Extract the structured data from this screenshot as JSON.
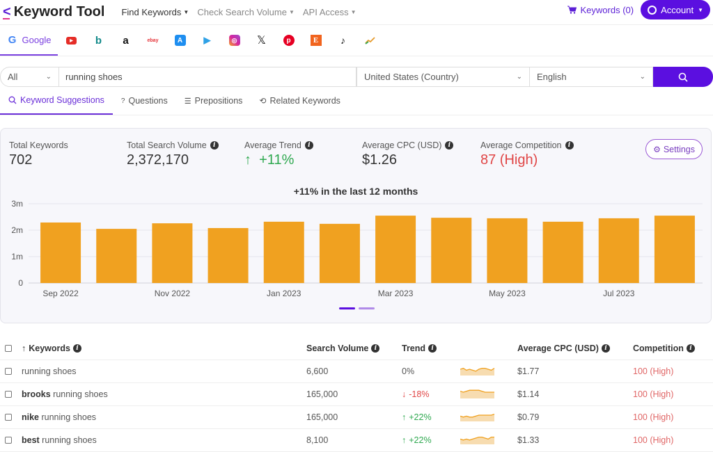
{
  "app": {
    "title": "Keyword Tool",
    "nav": [
      {
        "label": "Find Keywords",
        "active": true
      },
      {
        "label": "Check Search Volume",
        "active": false
      },
      {
        "label": "API Access",
        "active": false
      }
    ],
    "keywords_link": "Keywords (0)",
    "account_label": "Account"
  },
  "engines": [
    {
      "name": "google",
      "label": "Google",
      "active": true
    },
    {
      "name": "youtube"
    },
    {
      "name": "bing"
    },
    {
      "name": "amazon"
    },
    {
      "name": "ebay"
    },
    {
      "name": "app-store"
    },
    {
      "name": "play-store"
    },
    {
      "name": "instagram"
    },
    {
      "name": "x"
    },
    {
      "name": "pinterest"
    },
    {
      "name": "etsy"
    },
    {
      "name": "tiktok"
    },
    {
      "name": "trends"
    }
  ],
  "search": {
    "scope": "All",
    "query": "running shoes",
    "country": "United States (Country)",
    "language": "English"
  },
  "subtabs": [
    {
      "label": "Keyword Suggestions",
      "active": true
    },
    {
      "label": "Questions"
    },
    {
      "label": "Prepositions"
    },
    {
      "label": "Related Keywords"
    }
  ],
  "stats": {
    "total_keywords": {
      "label": "Total Keywords",
      "value": "702"
    },
    "total_search_volume": {
      "label": "Total Search Volume",
      "value": "2,372,170"
    },
    "average_trend": {
      "label": "Average Trend",
      "value": "+11%",
      "arrow": "↑"
    },
    "average_cpc": {
      "label": "Average CPC (USD)",
      "value": "$1.26"
    },
    "average_competition": {
      "label": "Average Competition",
      "value": "87 (High)"
    },
    "settings_label": "Settings"
  },
  "colors": {
    "accent": "#5b0fe0",
    "bar": "#f0a120",
    "positive": "#2ea84f",
    "negative": "#e04545"
  },
  "chart_data": {
    "type": "bar",
    "title": "+11% in the last 12 months",
    "categories": [
      "Sep 2022",
      "Oct 2022",
      "Nov 2022",
      "Dec 2022",
      "Jan 2023",
      "Feb 2023",
      "Mar 2023",
      "Apr 2023",
      "May 2023",
      "Jun 2023",
      "Jul 2023",
      "Aug 2023"
    ],
    "xtick_labels": [
      "Sep 2022",
      "",
      "Nov 2022",
      "",
      "Jan 2023",
      "",
      "Mar 2023",
      "",
      "May 2023",
      "",
      "Jul 2023",
      ""
    ],
    "values": [
      2290000,
      2050000,
      2260000,
      2080000,
      2320000,
      2240000,
      2550000,
      2470000,
      2450000,
      2320000,
      2450000,
      2550000
    ],
    "yticks": [
      "0",
      "1m",
      "2m",
      "3m"
    ],
    "ylim": [
      0,
      3000000
    ],
    "xlabel": "",
    "ylabel": "",
    "grid": true,
    "pagination": {
      "pages": 2,
      "current": 1
    }
  },
  "table": {
    "headers": {
      "keywords": "Keywords",
      "search_volume": "Search Volume",
      "trend": "Trend",
      "cpc": "Average CPC (USD)",
      "competition": "Competition"
    },
    "rows": [
      {
        "prefix": "",
        "keyword": "running shoes",
        "volume": "6,600",
        "trend": "0%",
        "trend_dir": "flat",
        "spark": [
          5,
          6,
          4,
          5,
          4,
          3,
          5,
          6,
          6,
          5,
          4,
          6
        ],
        "cpc": "$1.77",
        "competition": "100 (High)"
      },
      {
        "prefix": "brooks",
        "keyword": " running shoes",
        "volume": "165,000",
        "trend": "-18%",
        "trend_dir": "down",
        "spark": [
          6,
          5,
          6,
          7,
          7,
          7,
          7,
          6,
          5,
          5,
          5,
          5
        ],
        "cpc": "$1.14",
        "competition": "100 (High)"
      },
      {
        "prefix": "nike",
        "keyword": " running shoes",
        "volume": "165,000",
        "trend": "+22%",
        "trend_dir": "up",
        "spark": [
          4,
          3,
          4,
          3,
          3,
          4,
          5,
          5,
          5,
          5,
          5,
          6
        ],
        "cpc": "$0.79",
        "competition": "100 (High)"
      },
      {
        "prefix": "best",
        "keyword": " running shoes",
        "volume": "8,100",
        "trend": "+22%",
        "trend_dir": "up",
        "spark": [
          4,
          3,
          4,
          3,
          4,
          5,
          6,
          6,
          5,
          4,
          6,
          6
        ],
        "cpc": "$1.33",
        "competition": "100 (High)"
      }
    ]
  }
}
